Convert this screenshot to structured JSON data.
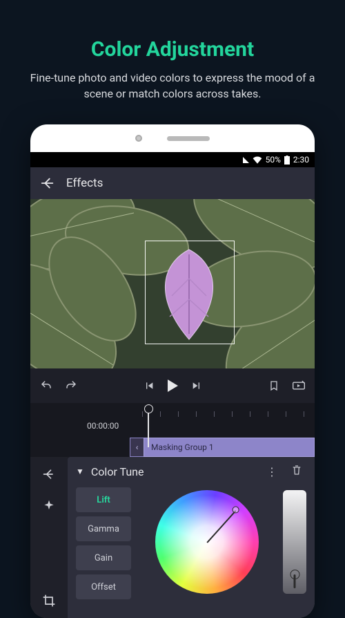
{
  "promo": {
    "title": "Color Adjustment",
    "subtitle": "Fine-tune photo and video colors to express the mood of a scene or match colors across takes."
  },
  "statusbar": {
    "battery_pct": "50%",
    "time": "2:30"
  },
  "navbar": {
    "title": "Effects"
  },
  "timeline": {
    "playhead_time": "00:00:00",
    "clip_label": "Masking Group 1",
    "clip_handle_glyph": "‹"
  },
  "fx": {
    "panel_title": "Color Tune",
    "tabs": [
      {
        "label": "Lift",
        "active": true
      },
      {
        "label": "Gamma",
        "active": false
      },
      {
        "label": "Gain",
        "active": false
      },
      {
        "label": "Offset",
        "active": false
      }
    ]
  },
  "icons": {
    "back": "arrow-left",
    "undo": "undo",
    "redo": "redo",
    "prev_key": "skip-start",
    "play": "play",
    "next_key": "skip-end",
    "bookmark": "bookmark",
    "loop": "loop-window",
    "side_back": "arrow-left",
    "side_sparkle": "sparkle",
    "side_crop": "crop",
    "more": "more-vert",
    "trash": "trash"
  },
  "colors": {
    "accent": "#23d59c"
  }
}
